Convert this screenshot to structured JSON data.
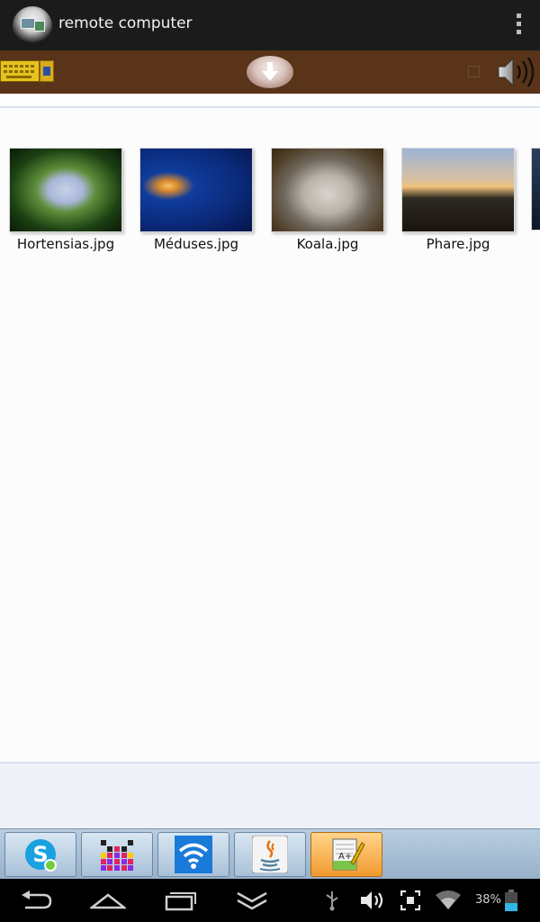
{
  "app": {
    "title": "remote computer"
  },
  "toolbar": {
    "icons": [
      "keyboard-icon",
      "download-arrow-icon",
      "checkbox-icon",
      "speaker-icon"
    ]
  },
  "files": [
    {
      "name": "Hortensias.jpg"
    },
    {
      "name": "Méduses.jpg"
    },
    {
      "name": "Koala.jpg"
    },
    {
      "name": "Phare.jpg"
    }
  ],
  "taskbar": {
    "apps": [
      "skype-icon",
      "pixel-grid-app-icon",
      "wifi-app-icon",
      "java-icon",
      "notepad-plus-plus-icon"
    ],
    "active_app": "notepad-plus-plus-icon"
  },
  "status": {
    "battery": "38%"
  },
  "colors": {
    "actionbar": "#1b1b1b",
    "toolbar": "#5a3418",
    "taskbar": "#a9c1d8",
    "active_task": "#f29a2e"
  }
}
